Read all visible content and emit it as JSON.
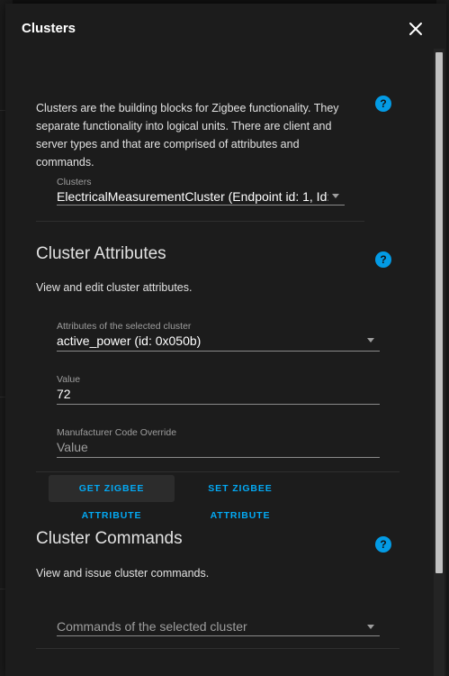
{
  "dialog": {
    "title": "Clusters",
    "close_icon": "close-icon"
  },
  "clusters_section": {
    "description": "Clusters are the building blocks for Zigbee functionality. They separate functionality into logical units. There are client and server types and that are comprised of attributes and commands.",
    "select_label": "Clusters",
    "select_value": "ElectricalMeasurementCluster (Endpoint id: 1, Id:"
  },
  "attributes_section": {
    "title": "Cluster Attributes",
    "description": "View and edit cluster attributes.",
    "attribute_label": "Attributes of the selected cluster",
    "attribute_value": "active_power (id: 0x050b)",
    "value_label": "Value",
    "value_value": "72",
    "manufacturer_label": "Manufacturer Code Override",
    "manufacturer_placeholder": "Value",
    "get_button": "GET ZIGBEE ATTRIBUTE",
    "set_button": "SET ZIGBEE ATTRIBUTE"
  },
  "commands_section": {
    "title": "Cluster Commands",
    "description": "View and issue cluster commands.",
    "command_placeholder": "Commands of the selected cluster"
  },
  "colors": {
    "accent": "#03a9f4",
    "dialog_bg": "#1c1c1c",
    "text": "#e1e1e1"
  }
}
